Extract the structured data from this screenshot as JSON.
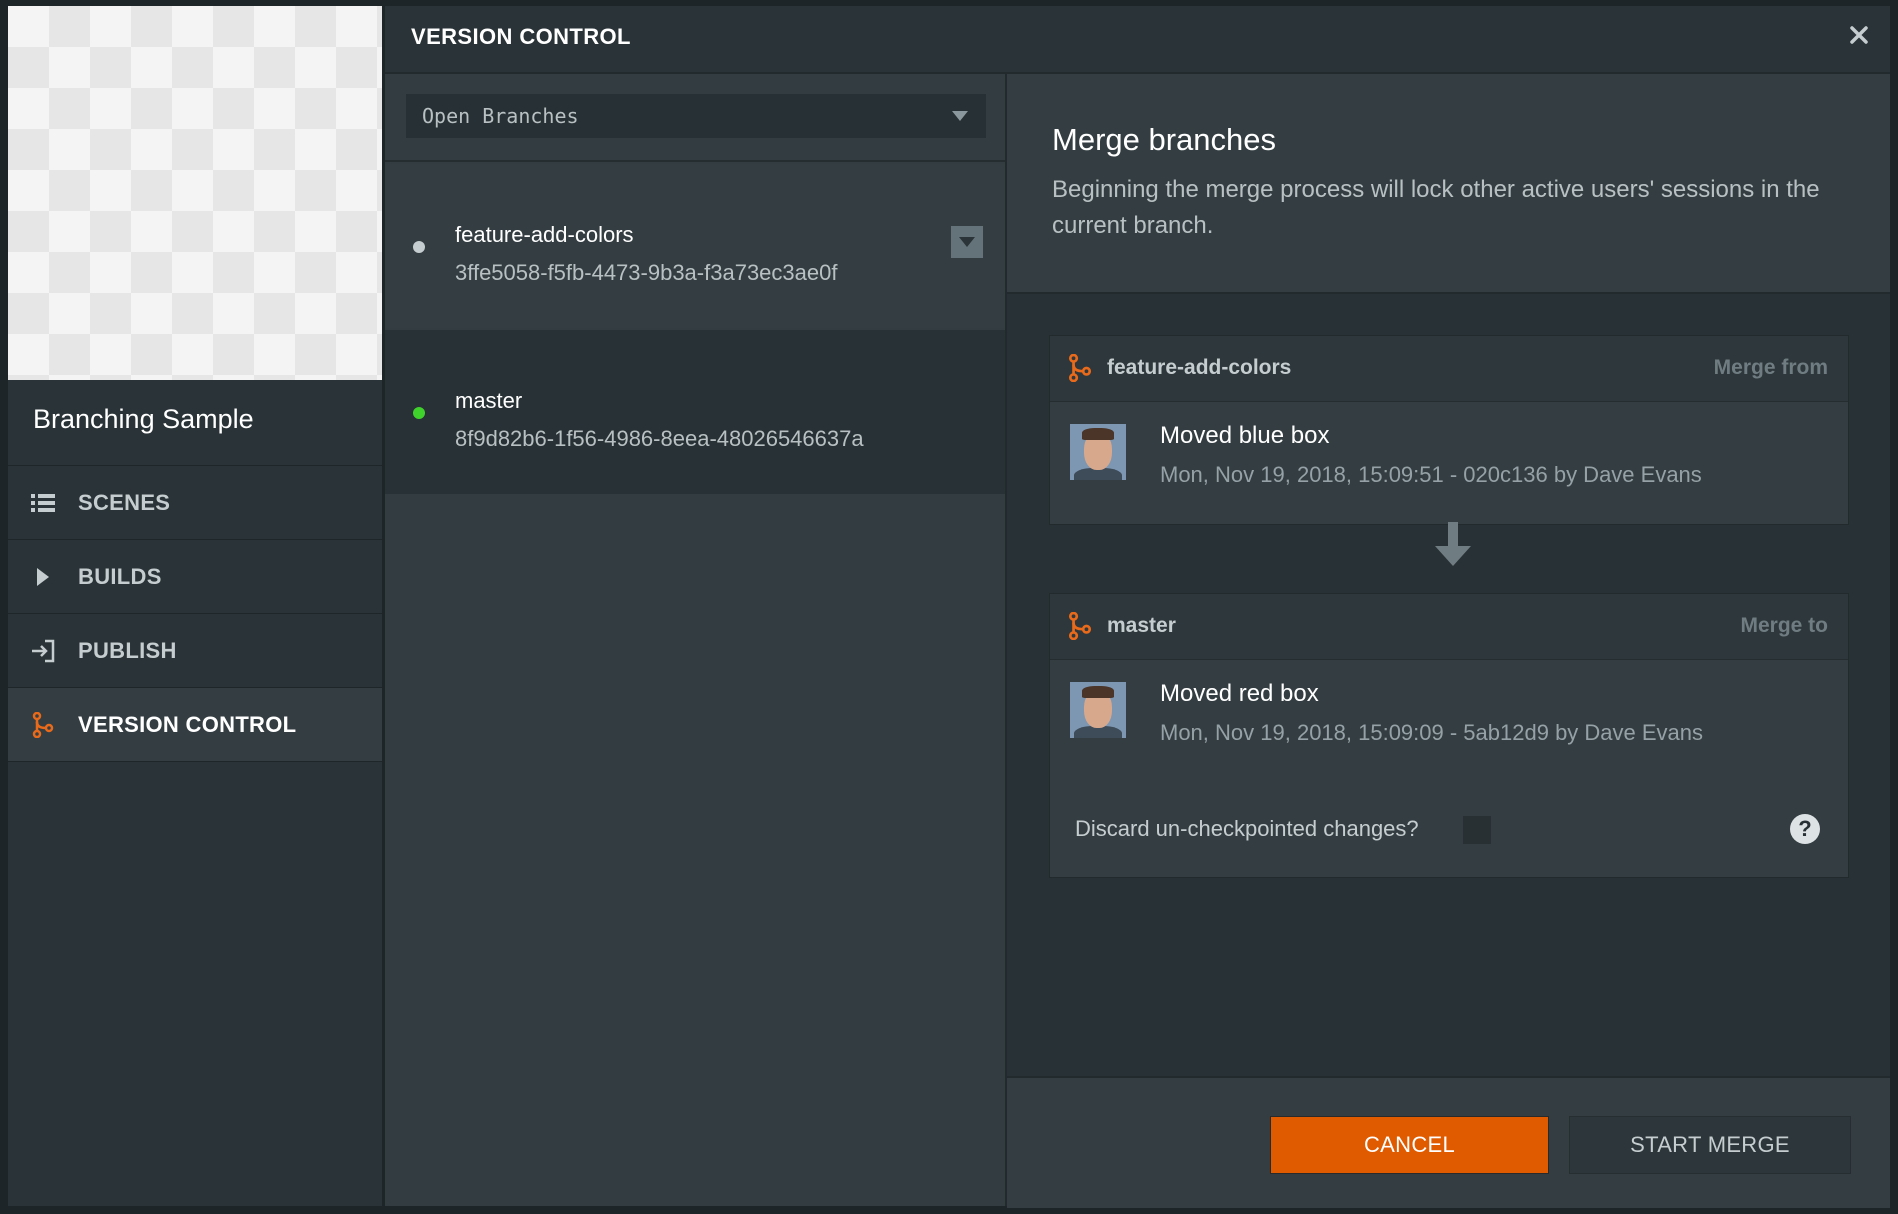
{
  "project": {
    "name": "Branching Sample"
  },
  "nav": {
    "items": [
      {
        "label": "SCENES",
        "icon": "list-icon"
      },
      {
        "label": "BUILDS",
        "icon": "play-icon"
      },
      {
        "label": "PUBLISH",
        "icon": "publish-icon"
      },
      {
        "label": "VERSION CONTROL",
        "icon": "branch-icon",
        "active": true
      }
    ]
  },
  "dialog": {
    "title": "VERSION CONTROL"
  },
  "branches": {
    "filter": "Open Branches",
    "items": [
      {
        "name": "feature-add-colors",
        "hash": "3ffe5058-f5fb-4473-9b3a-f3a73ec3ae0f",
        "status_color": "#c6cdd0"
      },
      {
        "name": "master",
        "hash": "8f9d82b6-1f56-4986-8eea-48026546637a",
        "status_color": "#3fd12c"
      }
    ]
  },
  "merge": {
    "title": "Merge branches",
    "description": "Beginning the merge process will lock other active users' sessions in the current branch.",
    "from": {
      "branch": "feature-add-colors",
      "role": "Merge from",
      "commit_title": "Moved blue box",
      "commit_meta": "Mon, Nov 19, 2018, 15:09:51 - 020c136 by Dave Evans"
    },
    "to": {
      "branch": "master",
      "role": "Merge to",
      "commit_title": "Moved red box",
      "commit_meta": "Mon, Nov 19, 2018, 15:09:09 - 5ab12d9 by Dave Evans"
    },
    "discard_label": "Discard un-checkpointed changes?",
    "help": "?",
    "cancel_label": "CANCEL",
    "start_label": "START MERGE"
  },
  "colors": {
    "accent": "#e05a00",
    "active_dot": "#3fd12c",
    "branch_icon": "#e86a1a"
  }
}
